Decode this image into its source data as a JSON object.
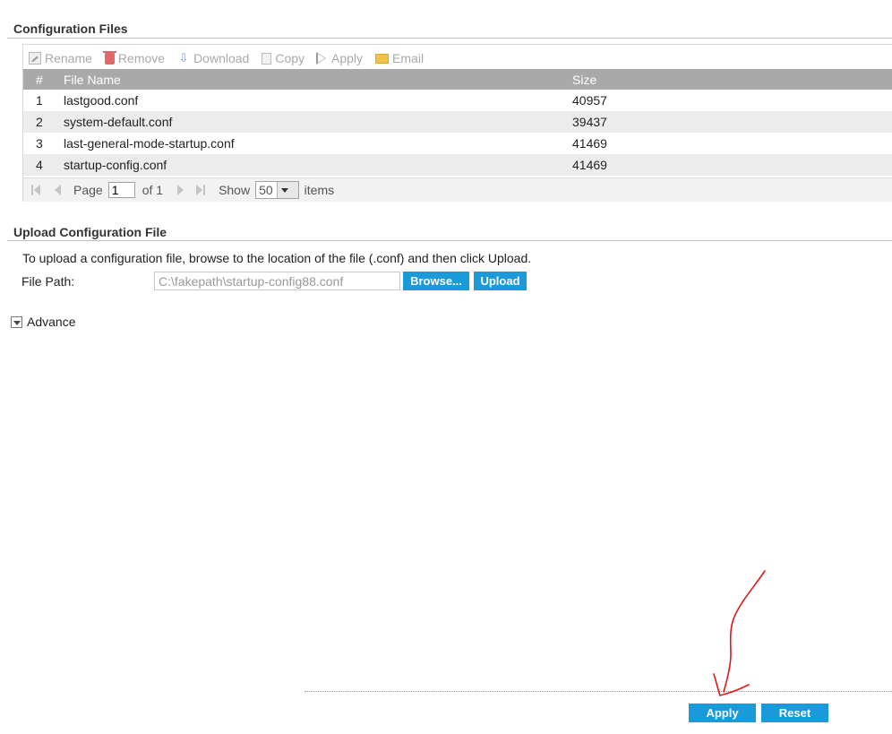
{
  "config_section": {
    "title": "Configuration Files",
    "toolbar": [
      {
        "label": "Rename",
        "icon": "rename-icon"
      },
      {
        "label": "Remove",
        "icon": "trash-icon"
      },
      {
        "label": "Download",
        "icon": "download-icon"
      },
      {
        "label": "Copy",
        "icon": "copy-icon"
      },
      {
        "label": "Apply",
        "icon": "apply-arrow-icon"
      },
      {
        "label": "Email",
        "icon": "email-icon"
      }
    ],
    "table": {
      "headers": {
        "num": "#",
        "name": "File Name",
        "size": "Size"
      },
      "rows": [
        {
          "num": "1",
          "name": "lastgood.conf",
          "size": "40957"
        },
        {
          "num": "2",
          "name": "system-default.conf",
          "size": "39437"
        },
        {
          "num": "3",
          "name": "last-general-mode-startup.conf",
          "size": "41469"
        },
        {
          "num": "4",
          "name": "startup-config.conf",
          "size": "41469"
        }
      ]
    },
    "pager": {
      "page_label": "Page",
      "page_value": "1",
      "of_label": "of 1",
      "show_label": "Show",
      "show_value": "50",
      "items_label": "items"
    }
  },
  "upload_section": {
    "title": "Upload Configuration File",
    "description": "To upload a configuration file, browse to the location of the file (.conf) and then click Upload.",
    "file_path_label": "File Path:",
    "file_path_value": "C:\\fakepath\\startup-config88.conf",
    "browse_label": "Browse...",
    "upload_label": "Upload"
  },
  "advance": {
    "label": "Advance"
  },
  "footer": {
    "apply_label": "Apply",
    "reset_label": "Reset"
  },
  "colors": {
    "accent": "#1a9ad8",
    "header_gray": "#a9a9a9",
    "annotation_red": "#e01818"
  }
}
